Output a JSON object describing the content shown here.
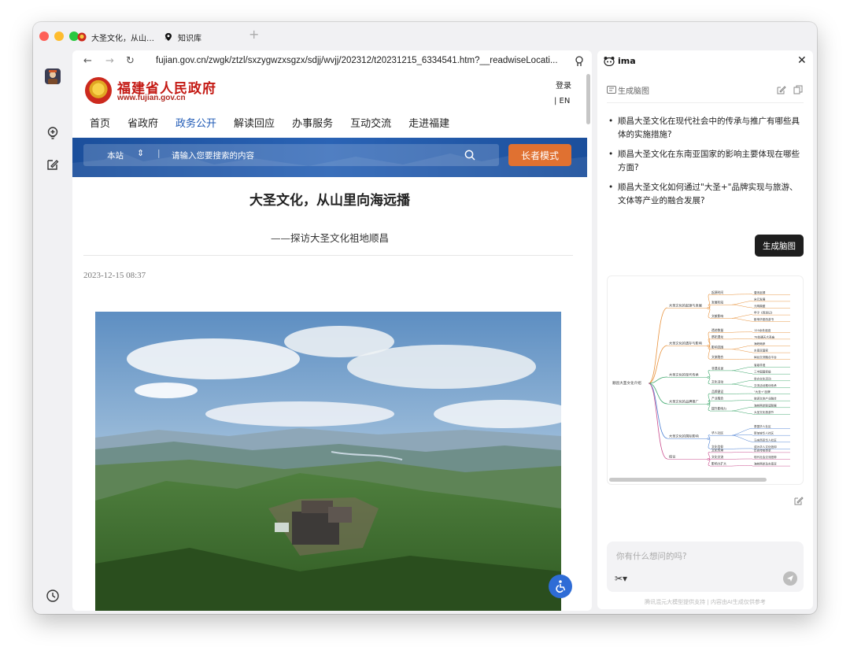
{
  "tabs": [
    {
      "title": "大圣文化，从山…",
      "icon": "gov-emblem-icon"
    },
    {
      "title": "知识库",
      "icon": "location-pin-icon"
    }
  ],
  "address": {
    "url": "fujian.gov.cn/zwgk/ztzl/sxzygwzxsgzx/sdjj/wvjj/202312/t20231215_6334541.htm?__readwiseLocati..."
  },
  "gov_site": {
    "title": "福建省人民政府",
    "domain": "www.fujian.gov.cn",
    "login": "登录",
    "lang": "| EN",
    "nav": [
      "首页",
      "省政府",
      "政务公开",
      "解读回应",
      "办事服务",
      "互动交流",
      "走进福建"
    ],
    "active_nav": "政务公开",
    "search_scope": "本站",
    "search_separator": "|",
    "search_placeholder": "请输入您要搜索的内容",
    "elder_mode": "长者模式"
  },
  "article": {
    "title": "大圣文化，从山里向海远播",
    "subtitle": "——探访大圣文化祖地顺昌",
    "date": "2023-12-15 08:37"
  },
  "ima": {
    "name": "ima",
    "section_label": "生成脑图",
    "questions": [
      "顺昌大圣文化在现代社会中的传承与推广有哪些具体的实施措施?",
      "顺昌大圣文化在东南亚国家的影响主要体现在哪些方面?",
      "顺昌大圣文化如何通过\"大圣+\"品牌实现与旅游、文体等产业的融合发展?"
    ],
    "generate_button": "生成脑图",
    "input_placeholder": "你有什么想问的吗?",
    "footnote": "腾讯混元大模型提供支持 | 内容由AI生成仅供参考"
  },
  "mindmap": {
    "root": "顺昌大圣文化介绍",
    "branches": [
      {
        "label": "大圣文化的起源与发展",
        "color": "#e8913a",
        "children": [
          {
            "label": "起源时间",
            "leaves": [
              "唐宋起源"
            ]
          },
          {
            "label": "发展阶段",
            "leaves": [
              "宋元发展",
              "元明鼎盛"
            ]
          },
          {
            "label": "文献影响",
            "leaves": [
              "甲子《西游记》",
              "影响华夏西游书"
            ]
          }
        ]
      },
      {
        "label": "大圣文化的遗存与影响",
        "color": "#e8913a",
        "children": [
          {
            "label": "遗迹数量",
            "leaves": [
              "120余处遗迹"
            ]
          },
          {
            "label": "祭祀遗址",
            "leaves": [
              "78处通天大圣庙"
            ]
          },
          {
            "label": "影响范围",
            "leaves": [
              "海峡两岸",
              "东南亚国家"
            ]
          },
          {
            "label": "文旅融合",
            "leaves": [
              "闽台交流融合平台"
            ]
          }
        ]
      },
      {
        "label": "大圣文化的现代传承",
        "color": "#3aa66a",
        "children": [
          {
            "label": "非遗名录",
            "leaves": [
              "省级非遗",
              "三中国国家级"
            ]
          },
          {
            "label": "文化活动",
            "leaves": [
              "举办文化活动",
              "交流活动推动传承"
            ]
          }
        ]
      },
      {
        "label": "大圣文化的品牌推广",
        "color": "#3aa66a",
        "children": [
          {
            "label": "品牌建设",
            "leaves": [
              "\"大圣+\"品牌"
            ]
          },
          {
            "label": "产业融合",
            "leaves": [
              "旅游文体产业融合"
            ]
          },
          {
            "label": "提升影响力",
            "leaves": [
              "海峡两岸联谊联展",
              "大圣文化旅游节"
            ]
          }
        ]
      },
      {
        "label": "大圣文化的国际影响",
        "color": "#4a7fd4",
        "children": [
          {
            "label": "华人社区",
            "leaves": [
              "泰国华人社区",
              "新加坡华人社区",
              "马来西亚华人社区"
            ]
          },
          {
            "label": "文化信仰",
            "leaves": [
              "成为华人文化信仰"
            ]
          }
        ]
      },
      {
        "label": "结论",
        "color": "#c94b8c",
        "children": [
          {
            "label": "文化传承",
            "leaves": [
              "历史传统传承"
            ]
          },
          {
            "label": "文化交流",
            "leaves": [
              "现代社会交流纽带"
            ]
          },
          {
            "label": "影响力扩大",
            "leaves": [
              "海峡两岸及东南亚"
            ]
          }
        ]
      }
    ]
  },
  "colors": {
    "gov_red": "#c41a14",
    "nav_active": "#1d58b5",
    "search_band": "#1f56a6",
    "elder_button": "#e07131",
    "ima_button": "#1e1e1e",
    "a11y_button": "#2e6cd6"
  }
}
